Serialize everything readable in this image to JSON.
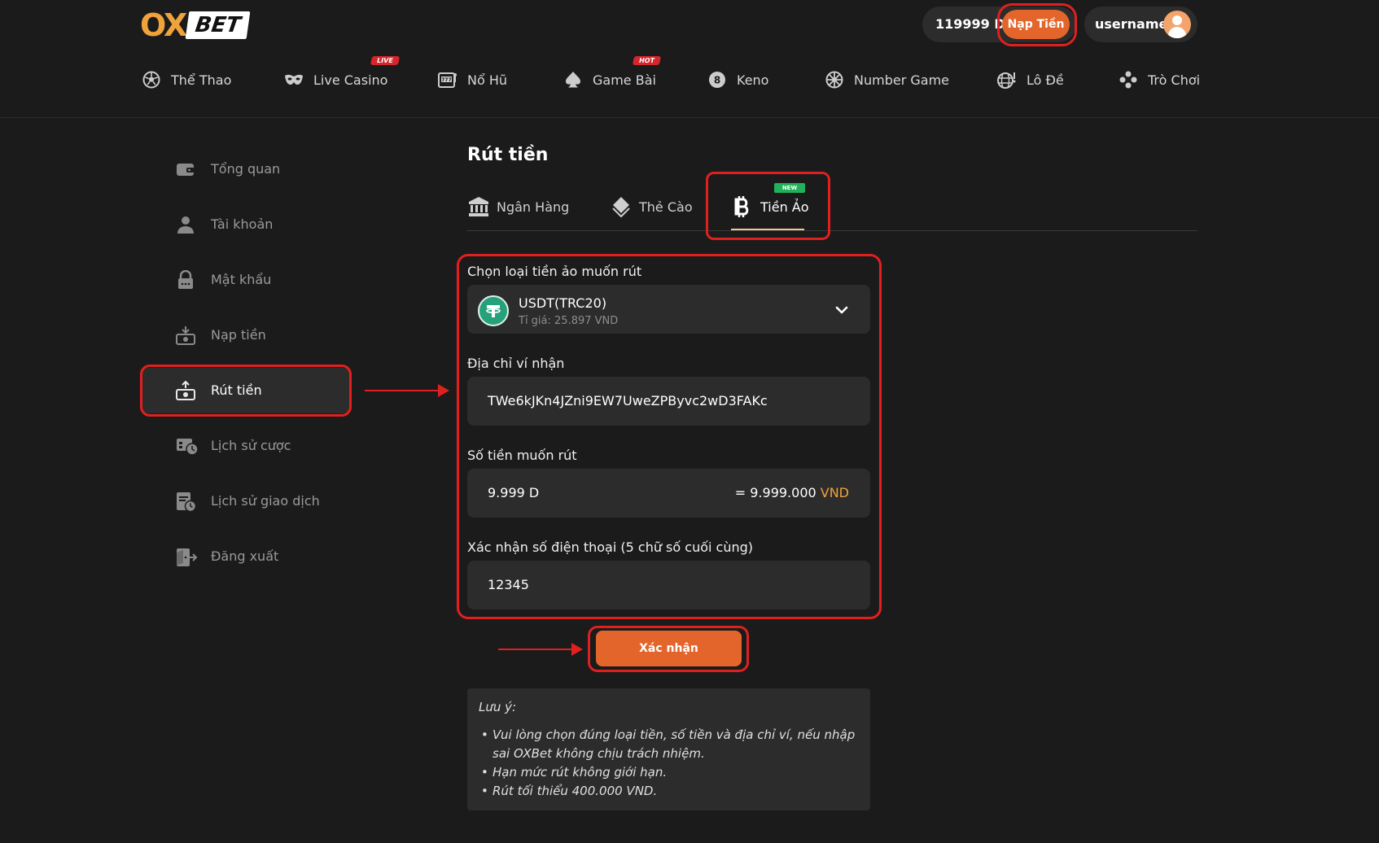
{
  "brand": {
    "logo_left": "OX",
    "logo_right": "BET"
  },
  "header": {
    "balance": "119999 D",
    "deposit_label": "Nạp Tiền",
    "username": "username"
  },
  "nav": [
    {
      "label": "Thể Thao",
      "icon": "soccer-ball-icon"
    },
    {
      "label": "Live Casino",
      "icon": "mask-icon",
      "badge": "LIVE"
    },
    {
      "label": "Nổ Hũ",
      "icon": "slot-machine-icon"
    },
    {
      "label": "Game Bài",
      "icon": "spade-icon",
      "badge": "HOT"
    },
    {
      "label": "Keno",
      "icon": "keno-ball-icon",
      "icon_text": "8"
    },
    {
      "label": "Number Game",
      "icon": "number-wheel-icon"
    },
    {
      "label": "Lô Đề",
      "icon": "lottery-icon"
    },
    {
      "label": "Trò Chơi",
      "icon": "gamepad-icon"
    }
  ],
  "sidebar": [
    {
      "label": "Tổng quan",
      "icon": "wallet-icon"
    },
    {
      "label": "Tài khoản",
      "icon": "user-icon"
    },
    {
      "label": "Mật khẩu",
      "icon": "lock-icon"
    },
    {
      "label": "Nạp tiền",
      "icon": "deposit-icon"
    },
    {
      "label": "Rút tiền",
      "icon": "withdraw-icon",
      "active": true
    },
    {
      "label": "Lịch sử cược",
      "icon": "bet-history-icon"
    },
    {
      "label": "Lịch sử giao dịch",
      "icon": "transaction-history-icon"
    },
    {
      "label": "Đăng xuất",
      "icon": "logout-icon"
    }
  ],
  "main": {
    "title": "Rút tiền",
    "tabs": [
      {
        "label": "Ngân Hàng",
        "icon": "bank-icon"
      },
      {
        "label": "Thẻ Cào",
        "icon": "card-icon"
      },
      {
        "label": "Tiền Ảo",
        "icon": "bitcoin-icon",
        "active": true,
        "badge": "NEW"
      }
    ],
    "crypto_label": "Chọn loại tiền ảo muốn rút",
    "crypto_selected": "USDT(TRC20)",
    "crypto_rate": "Tỉ giá: 25.897 VND",
    "address_label": "Địa chỉ ví nhận",
    "address_value": "TWe6kJKn4JZni9EW7UweZPByvc2wD3FAKc",
    "amount_label": "Số tiền muốn rút",
    "amount_value": "9.999 D",
    "amount_converted": "= 9.999.000",
    "amount_unit": "VND",
    "phone_label": "Xác nhận số điện thoại (5 chữ số cuối cùng)",
    "phone_value": "12345",
    "confirm_label": "Xác nhận",
    "note_title": "Lưu ý:",
    "note_items": [
      "Vui lòng chọn đúng loại tiền, số tiền và địa chỉ ví, nếu nhập sai OXBet không chịu trách nhiệm.",
      "Hạn mức rút không giới hạn.",
      "Rút tối thiểu 400.000 VND."
    ]
  },
  "colors": {
    "accent": "#e4652b",
    "gold": "#f0a33a",
    "annotation": "#e0201f",
    "new_badge": "#1fb25a",
    "tether": "#26a17b"
  }
}
